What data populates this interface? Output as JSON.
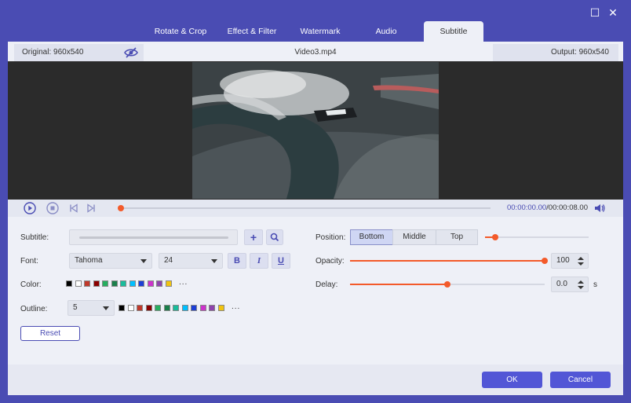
{
  "window": {
    "maximize_icon": "maximize-icon",
    "close_icon": "close-icon"
  },
  "tabs": [
    {
      "label": "Rotate & Crop"
    },
    {
      "label": "Effect & Filter"
    },
    {
      "label": "Watermark"
    },
    {
      "label": "Audio"
    },
    {
      "label": "Subtitle",
      "active": true
    }
  ],
  "infobar": {
    "original": "Original: 960x540",
    "filename": "Video3.mp4",
    "output": "Output: 960x540"
  },
  "playback": {
    "current_time": "00:00:00.00",
    "total_time": "/00:00:08.00",
    "progress": 0
  },
  "subtitle_panel": {
    "subtitle_label": "Subtitle:",
    "subtitle_file": "",
    "font_label": "Font:",
    "font_name": "Tahoma",
    "font_size": "24",
    "bold": "B",
    "italic": "I",
    "underline": "U",
    "color_label": "Color:",
    "outline_label": "Outline:",
    "outline_value": "5",
    "reset_label": "Reset",
    "more": "..."
  },
  "swatch_colors": [
    "#000000",
    "#ffffff",
    "#c0392b",
    "#8b0000",
    "#27ae60",
    "#1a7f4b",
    "#1abc9c",
    "#00bfff",
    "#1c3fd6",
    "#cc33cc",
    "#8e44ad",
    "#f1c40f"
  ],
  "right_panel": {
    "position_label": "Position:",
    "positions": [
      "Bottom",
      "Middle",
      "Top"
    ],
    "selected_position": "Bottom",
    "position_offset": 0.1,
    "opacity_label": "Opacity:",
    "opacity_value": "100",
    "delay_label": "Delay:",
    "delay_value": "0.0",
    "delay_unit": "s",
    "delay_slider": 0.5
  },
  "footer": {
    "ok_label": "OK",
    "cancel_label": "Cancel"
  },
  "colors": {
    "accent": "#4a4cb3",
    "slider": "#f35a2a",
    "button": "#5256d6"
  }
}
